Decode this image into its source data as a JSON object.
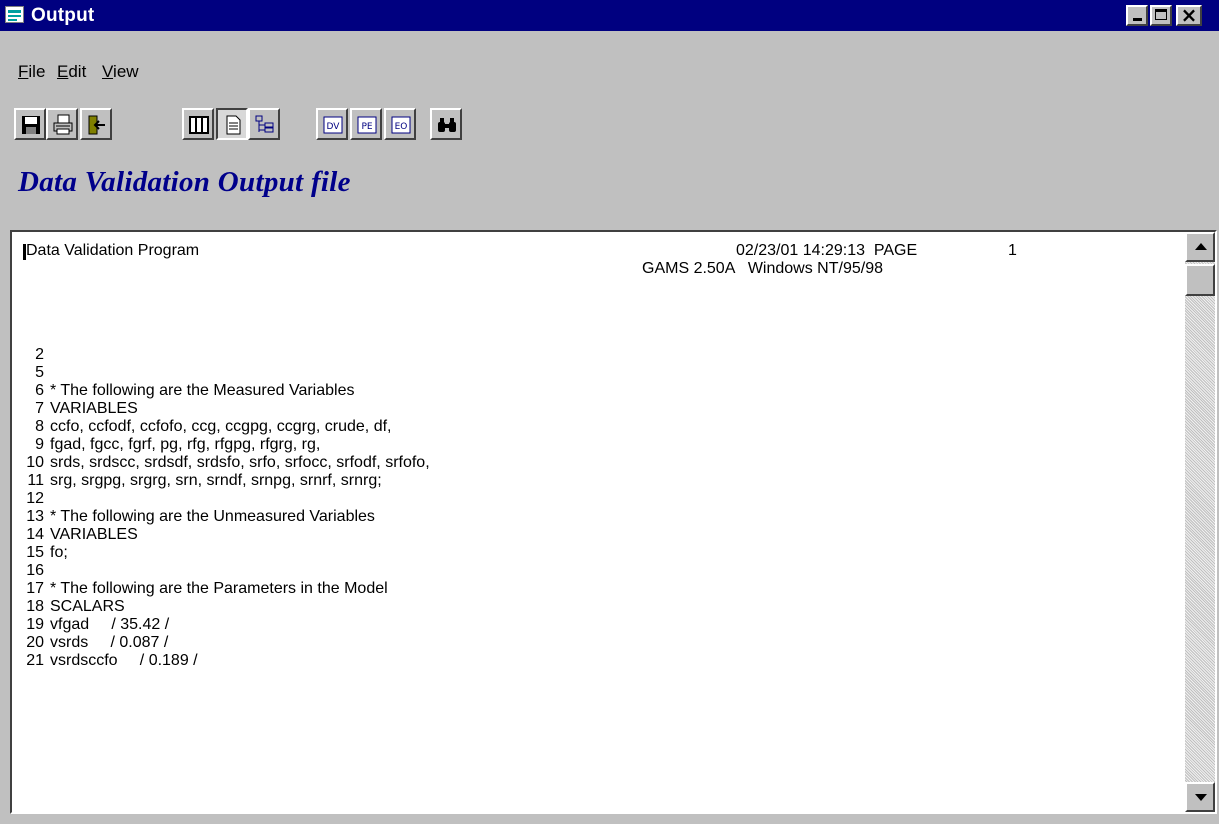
{
  "window": {
    "title": "Output",
    "minimize_label": "_",
    "maximize_label": "□",
    "close_label": "×"
  },
  "menu": {
    "file": {
      "first": "F",
      "rest": "ile"
    },
    "edit": {
      "first": "E",
      "rest": "dit"
    },
    "view": {
      "first": "V",
      "rest": "iew"
    }
  },
  "toolbar": {
    "buttons": [
      {
        "icon": "save-icon"
      },
      {
        "icon": "print-icon"
      },
      {
        "icon": "exit-icon"
      },
      {
        "icon": "table-view-icon"
      },
      {
        "icon": "page-view-icon",
        "pressed": true
      },
      {
        "icon": "tree-view-icon"
      },
      {
        "icon": "dv-icon",
        "label": "DV"
      },
      {
        "icon": "pe-icon",
        "label": "PE"
      },
      {
        "icon": "eo-icon",
        "label": "EO"
      },
      {
        "icon": "binoculars-find-icon"
      }
    ]
  },
  "heading": "Data Validation Output file",
  "output": {
    "program_title": "Data Validation Program",
    "date_time": "02/23/01 14:29:13  PAGE",
    "page_number": "1",
    "gams_version": "GAMS 2.50A   Windows NT/95/98",
    "lines": [
      {
        "num": "2",
        "text": ""
      },
      {
        "num": "5",
        "text": ""
      },
      {
        "num": "6",
        "text": "* The following are the Measured Variables"
      },
      {
        "num": "7",
        "text": "VARIABLES"
      },
      {
        "num": "8",
        "text": "ccfo, ccfodf, ccfofo, ccg, ccgpg, ccgrg, crude, df,"
      },
      {
        "num": "9",
        "text": "fgad, fgcc, fgrf, pg, rfg, rfgpg, rfgrg, rg,"
      },
      {
        "num": "10",
        "text": "srds, srdscc, srdsdf, srdsfo, srfo, srfocc, srfodf, srfofo,"
      },
      {
        "num": "11",
        "text": "srg, srgpg, srgrg, srn, srndf, srnpg, srnrf, srnrg;"
      },
      {
        "num": "12",
        "text": ""
      },
      {
        "num": "13",
        "text": "* The following are the Unmeasured Variables"
      },
      {
        "num": "14",
        "text": "VARIABLES"
      },
      {
        "num": "15",
        "text": "fo;"
      },
      {
        "num": "16",
        "text": ""
      },
      {
        "num": "17",
        "text": "* The following are the Parameters in the Model"
      },
      {
        "num": "18",
        "text": "SCALARS"
      },
      {
        "num": "19",
        "text": "vfgad     / 35.42 /"
      },
      {
        "num": "20",
        "text": "vsrds     / 0.087 /"
      },
      {
        "num": "21",
        "text": "vsrdsccfo     / 0.189 /"
      }
    ]
  },
  "colors": {
    "titlebar": "#000080",
    "heading": "#00008b",
    "face": "#c0c0c0"
  }
}
